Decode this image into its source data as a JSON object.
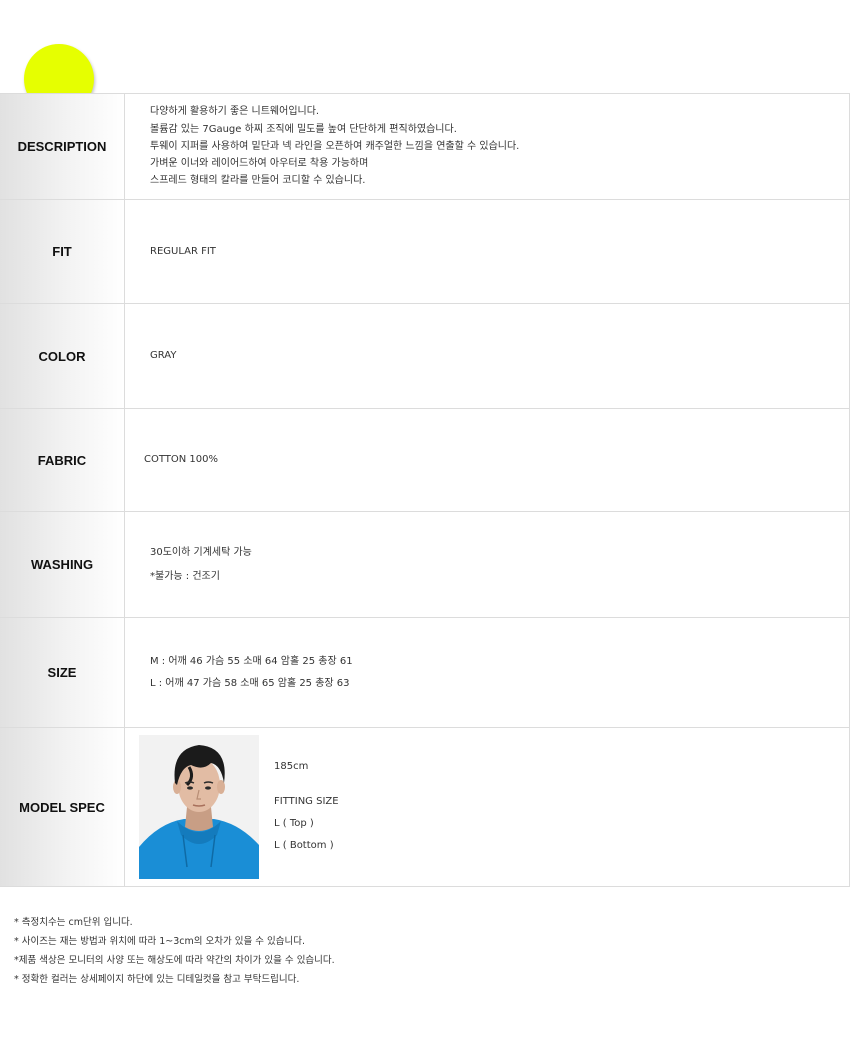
{
  "rows": {
    "description": {
      "label": "DESCRIPTION",
      "lines": [
        "다양하게 활용하기 좋은 니트웨어입니다.",
        "볼륨감 있는 7Gauge 하찌 조직에 밀도를 높여 단단하게 편직하였습니다.",
        "투웨이 지퍼를 사용하여 밑단과 넥 라인을 오픈하여 캐주얼한 느낌을 연출할 수 있습니다.",
        "가벼운 이너와 레이어드하여 아우터로 착용 가능하며",
        "스프레드 형태의 칼라를 만들어 코디할 수 있습니다."
      ]
    },
    "fit": {
      "label": "FIT",
      "value": "REGULAR FIT"
    },
    "color": {
      "label": "COLOR",
      "value": "GRAY"
    },
    "fabric": {
      "label": "FABRIC",
      "value": "COTTON 100%"
    },
    "washing": {
      "label": "WASHING",
      "lines": [
        "30도이하 기계세탁 가능",
        "*불가능 : 건조기"
      ]
    },
    "size": {
      "label": "SIZE",
      "lines": [
        "M : 어깨 46  가슴 55  소매 64  암홀 25  총장 61",
        "L  : 어깨 47  가슴 58  소매 65  암홀 25  총장 63"
      ]
    },
    "model_spec": {
      "label": "MODEL SPEC",
      "height": "185cm",
      "fitting_title": "FITTING SIZE",
      "fitting_lines": [
        "L ( Top )",
        "L ( Bottom )"
      ]
    }
  },
  "notes": [
    "* 측정치수는 cm단위 입니다.",
    "* 사이즈는 재는 방법과 위치에 따라 1~3cm의 오차가 있을 수 있습니다.",
    "*제품 색상은 모니터의 사양 또는 해상도에 따라 약간의 차이가 있을 수 있습니다.",
    "* 정확한 컬러는 상세페이지 하단에 있는 디테일컷을 참고 부탁드립니다."
  ],
  "colors": {
    "accent_dot": "#e6ff00",
    "hoodie": "#1a8ed6"
  },
  "icons": {
    "model_photo": "model-portrait-photo"
  }
}
